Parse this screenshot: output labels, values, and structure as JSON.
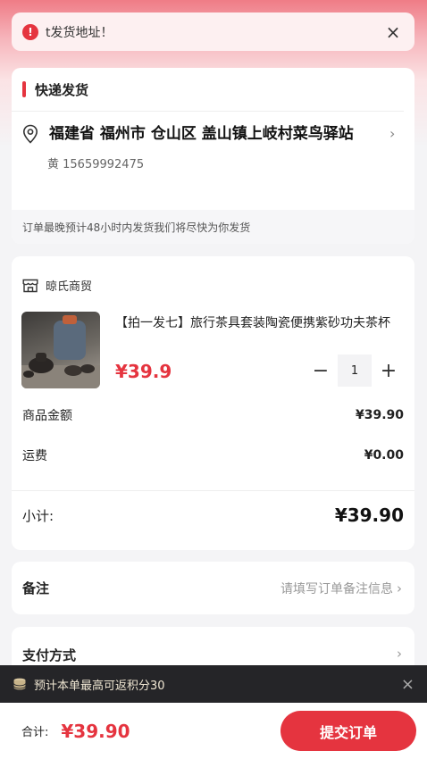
{
  "notice": {
    "text": "t发货地址！",
    "icon": "exclamation-icon",
    "close": "×"
  },
  "shipping": {
    "title": "快递发货",
    "address": "福建省 福州市 仓山区 盖山镇上岐村菜鸟驿站",
    "phone": "黄 15659992475",
    "eta": "订单最晚预计48小时内发货我们将尽快为你发货"
  },
  "order": {
    "shop_name": "晾氏商贸",
    "product": {
      "title": "【拍一发七】旅行茶具套装陶瓷便携紫砂功夫茶杯",
      "price": "¥39.9",
      "quantity": "1",
      "minus": "−",
      "plus": "+"
    },
    "goods_amount_label": "商品金额",
    "goods_amount": "¥39.90",
    "shipping_fee_label": "运费",
    "shipping_fee": "¥0.00",
    "subtotal_label": "小计:",
    "subtotal": "¥39.90"
  },
  "remark": {
    "label": "备注",
    "hint": "请填写订单备注信息"
  },
  "payment": {
    "label": "支付方式"
  },
  "points_tip": {
    "text": "预计本单最高可返积分30",
    "icon": "coins-icon",
    "close": "×"
  },
  "footer": {
    "total_label": "合计:",
    "total": "¥39.90",
    "submit": "提交订单"
  },
  "colors": {
    "accent": "#e5343f",
    "points_bar": "#252528"
  }
}
